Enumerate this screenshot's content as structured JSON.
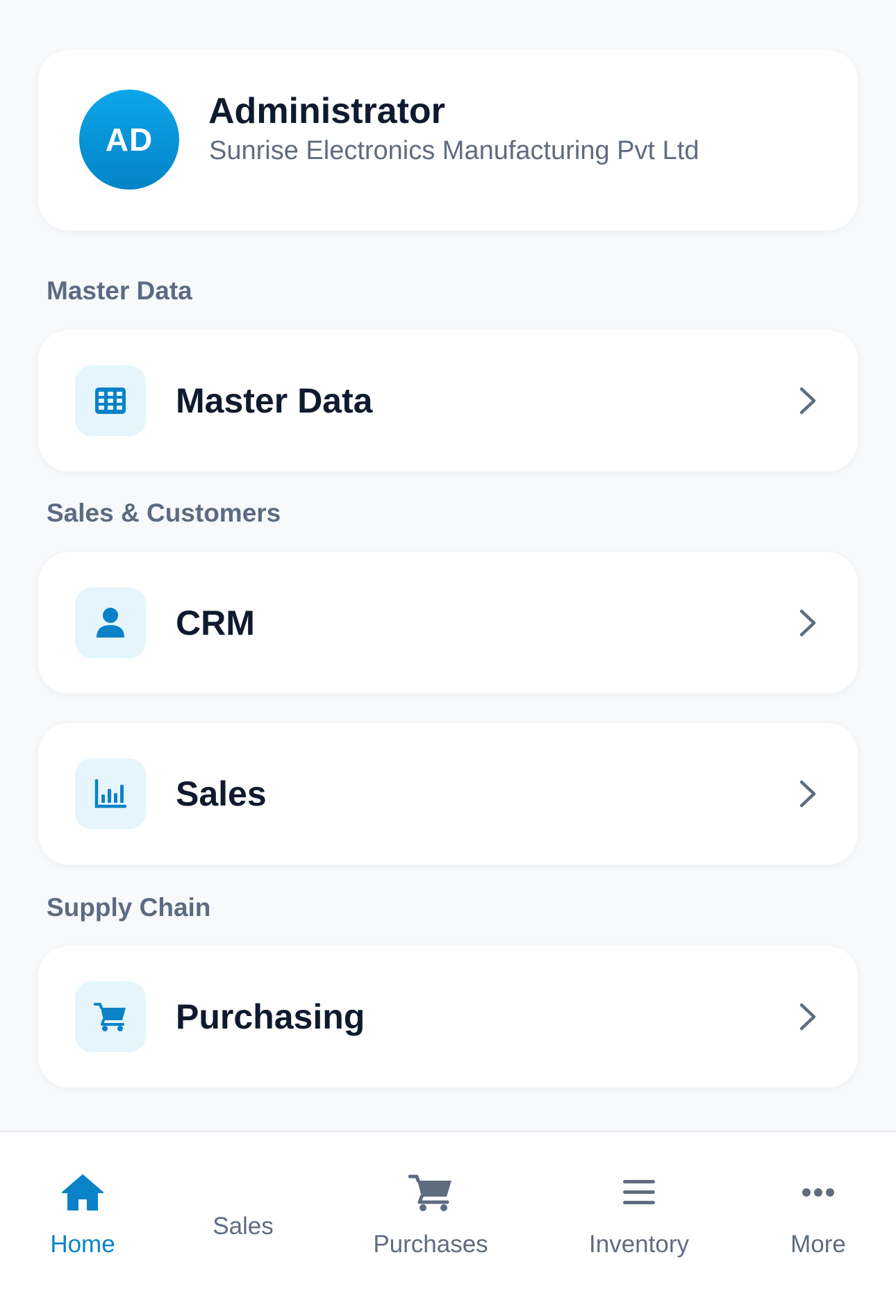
{
  "profile": {
    "initials": "AD",
    "name": "Administrator",
    "company": "Sunrise Electronics Manufacturing Pvt Ltd"
  },
  "sections": [
    {
      "title": "Master Data",
      "items": [
        {
          "label": "Master Data",
          "icon": "grid-icon"
        }
      ]
    },
    {
      "title": "Sales & Customers",
      "items": [
        {
          "label": "CRM",
          "icon": "user-icon"
        },
        {
          "label": "Sales",
          "icon": "bar-chart-icon"
        }
      ]
    },
    {
      "title": "Supply Chain",
      "items": [
        {
          "label": "Purchasing",
          "icon": "cart-icon"
        }
      ]
    }
  ],
  "bottom_nav": [
    {
      "label": "Home",
      "icon": "home-icon",
      "active": true
    },
    {
      "label": "Sales",
      "icon": "",
      "active": false
    },
    {
      "label": "Purchases",
      "icon": "cart-icon",
      "active": false
    },
    {
      "label": "Inventory",
      "icon": "menu-icon",
      "active": false
    },
    {
      "label": "More",
      "icon": "more-icon",
      "active": false
    }
  ],
  "colors": {
    "accent": "#0b82c8",
    "icon_bg": "#e6f5fc",
    "background": "#f7f9fb",
    "text_primary": "#0f1a2e",
    "text_secondary": "#5f6c80"
  }
}
